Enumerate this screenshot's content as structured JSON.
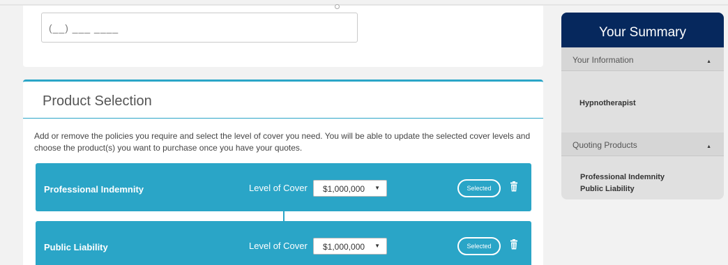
{
  "contact": {
    "phone_mask": "(__) ___ ____"
  },
  "product_selection": {
    "title": "Product Selection",
    "description": "Add or remove the policies you require and select the level of cover you need. You will be able to update the selected cover levels and choose the product(s) you want to purchase once you have your quotes.",
    "products": [
      {
        "name": "Professional Indemnity",
        "cover_label": "Level of Cover",
        "cover_value": "$1,000,000",
        "status": "Selected"
      },
      {
        "name": "Public Liability",
        "cover_label": "Level of Cover",
        "cover_value": "$1,000,000",
        "status": "Selected"
      }
    ]
  },
  "summary": {
    "title": "Your Summary",
    "info_header": "Your Information",
    "occupation": "Hypnotherapist",
    "quoting_header": "Quoting Products",
    "quoting_products": [
      "Professional Indemnity",
      "Public Liability"
    ]
  },
  "colors": {
    "accent": "#2aa5c7",
    "summary_header": "#06285d",
    "summary_bg": "#e0e0e0"
  },
  "icons": {
    "delete": "trash-icon",
    "dropdown": "caret-down-icon",
    "collapse": "caret-up-icon"
  }
}
